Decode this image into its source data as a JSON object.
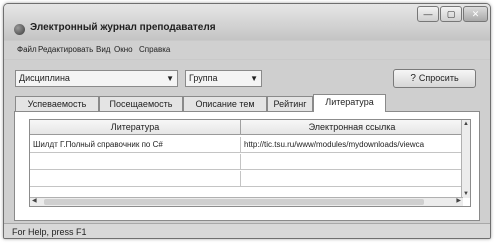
{
  "window": {
    "title": "Электронный журнал преподавателя",
    "controls": {
      "minimize": "—",
      "maximize": "▢",
      "close": "✕"
    }
  },
  "menu": [
    "Файл",
    "Редактировать",
    "Вид",
    "Окно",
    "Справка"
  ],
  "toolbar": {
    "discipline": "Дисциплина",
    "group": "Группа",
    "ask_button": "Спросить",
    "ask_icon": "?"
  },
  "tabs": [
    "Успеваемость",
    "Посещаемость",
    "Описание тем",
    "Рейтинг",
    "Литература"
  ],
  "active_tab": "Литература",
  "table": {
    "columns": [
      "Литература",
      "Электронная ссылка"
    ],
    "rows": [
      [
        "Шилдт Г.Полный справочник по C#",
        "http://tic.tsu.ru/www/modules/mydownloads/viewca"
      ]
    ]
  },
  "status": {
    "text": "For Help, press F1"
  }
}
